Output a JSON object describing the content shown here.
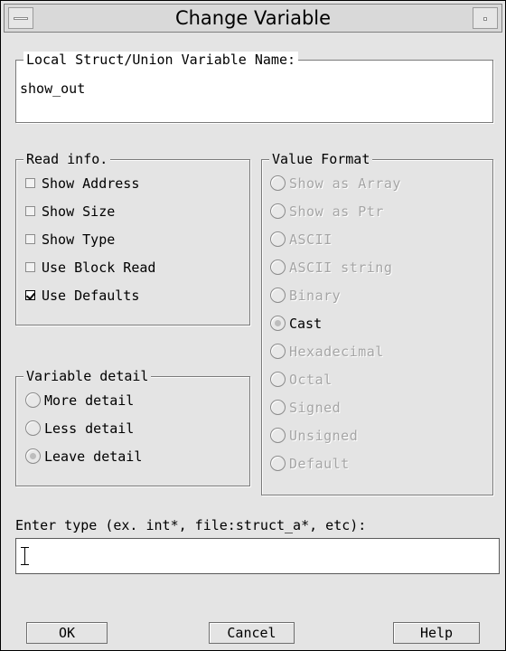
{
  "window": {
    "title": "Change Variable"
  },
  "name_group": {
    "legend": "Local Struct/Union Variable Name:",
    "value": "show_out"
  },
  "read_info": {
    "legend": "Read info.",
    "options": [
      {
        "label": "Show Address",
        "checked": false
      },
      {
        "label": "Show Size",
        "checked": false
      },
      {
        "label": "Show Type",
        "checked": false
      },
      {
        "label": "Use Block Read",
        "checked": false
      },
      {
        "label": "Use Defaults",
        "checked": true
      }
    ]
  },
  "variable_detail": {
    "legend": "Variable detail",
    "options": [
      {
        "label": "More detail",
        "selected": false
      },
      {
        "label": "Less detail",
        "selected": false
      },
      {
        "label": "Leave detail",
        "selected": true
      }
    ]
  },
  "value_format": {
    "legend": "Value Format",
    "options": [
      {
        "label": "Show as Array",
        "enabled": false,
        "selected": false
      },
      {
        "label": "Show as Ptr",
        "enabled": false,
        "selected": false
      },
      {
        "label": "ASCII",
        "enabled": false,
        "selected": false
      },
      {
        "label": "ASCII string",
        "enabled": false,
        "selected": false
      },
      {
        "label": "Binary",
        "enabled": false,
        "selected": false
      },
      {
        "label": "Cast",
        "enabled": true,
        "selected": true
      },
      {
        "label": "Hexadecimal",
        "enabled": false,
        "selected": false
      },
      {
        "label": "Octal",
        "enabled": false,
        "selected": false
      },
      {
        "label": "Signed",
        "enabled": false,
        "selected": false
      },
      {
        "label": "Unsigned",
        "enabled": false,
        "selected": false
      },
      {
        "label": "Default",
        "enabled": false,
        "selected": false
      }
    ]
  },
  "type_entry": {
    "prompt": "Enter type (ex. int*, file:struct_a*, etc):",
    "value": ""
  },
  "buttons": {
    "ok": "OK",
    "cancel": "Cancel",
    "help": "Help"
  },
  "icons": {
    "window_menu": "window-menu-icon",
    "minimize": "minimize-icon",
    "text_cursor": "text-cursor-icon"
  }
}
